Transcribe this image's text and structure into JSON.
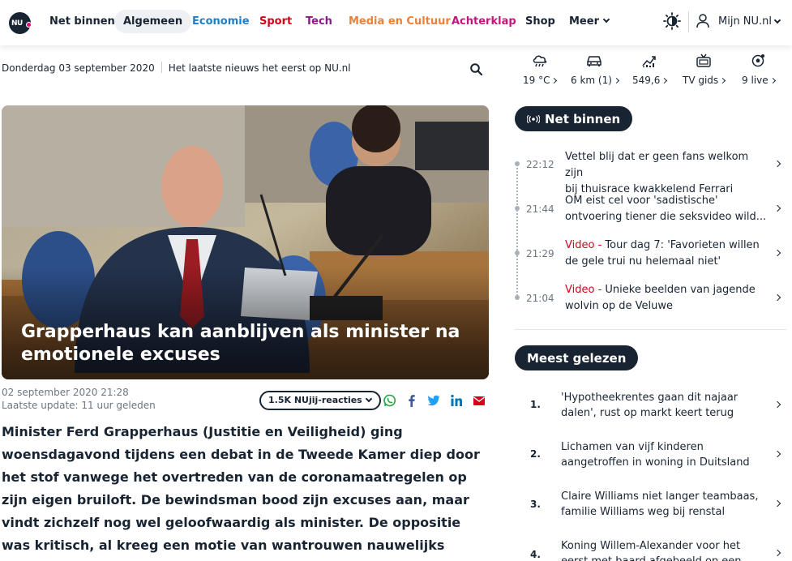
{
  "nav": {
    "logo_text": "NU",
    "items": [
      {
        "label": "Net binnen",
        "color": "#192433"
      },
      {
        "label": "Algemeen",
        "color": "#192433"
      },
      {
        "label": "Economie",
        "color": "#1c7fc8"
      },
      {
        "label": "Sport",
        "color": "#d4001a"
      },
      {
        "label": "Tech",
        "color": "#8a1a8c"
      },
      {
        "label": "Media en Cultuur",
        "color": "#e8823a"
      },
      {
        "label": "Achterklap",
        "color": "#c4177e"
      },
      {
        "label": "Shop",
        "color": "#192433"
      },
      {
        "label": "Meer",
        "color": "#192433"
      }
    ],
    "account_label": "Mijn NU.nl"
  },
  "datebar": {
    "date": "Donderdag 03 september 2020",
    "tagline": "Het laatste nieuws het eerst op NU.nl"
  },
  "widgets": [
    {
      "icon": "weather-icon",
      "value": "19 °C"
    },
    {
      "icon": "traffic-icon",
      "value": "6 km (1)"
    },
    {
      "icon": "stocks-icon",
      "value": "549,6"
    },
    {
      "icon": "tv-icon",
      "value": "TV gids"
    },
    {
      "icon": "live-sport-icon",
      "value": "9 live"
    }
  ],
  "article": {
    "headline_line1": "Grapperhaus kan aanblijven als minister na",
    "headline_line2": "emotionele excuses",
    "published": "02 september 2020 21:28",
    "updated": "Laatste update: 11 uur geleden",
    "reactions_label": "1.5K NUjij-reacties",
    "intro": "Minister Ferd Grapperhaus (Justitie en Veiligheid) ging woensdagavond tijdens een debat in de Tweede Kamer diep door het stof vanwege het overtreden van de coronamaatregelen op zijn eigen bruiloft. De bewindsman bood zijn excuses aan, maar vindt zichzelf nog wel geloofwaardig als minister. De oppositie was kritisch, al kreeg een motie van wantrouwen nauwelijks steun."
  },
  "net_binnen": {
    "title": "Net binnen",
    "items": [
      {
        "time": "22:12",
        "prefix": "",
        "line1": "Vettel blij dat er geen fans welkom zijn",
        "line2": "bij thuisrace kwakkelend Ferrari"
      },
      {
        "time": "21:44",
        "prefix": "",
        "line1": "OM eist cel voor 'sadistische'",
        "line2": "ontvoering tiener die seksvideo wild..."
      },
      {
        "time": "21:29",
        "prefix": "Video",
        "line1": "Tour dag 7: 'Favorieten willen",
        "line2": "de gele trui nu helemaal niet'"
      },
      {
        "time": "21:04",
        "prefix": "Video",
        "line1": "Unieke beelden van jagende",
        "line2": "wolvin op de Veluwe"
      }
    ]
  },
  "meest_gelezen": {
    "title": "Meest gelezen",
    "items": [
      {
        "num": "1.",
        "line1": "'Hypotheekrentes gaan dit najaar",
        "line2": "dalen', rust op markt keert terug"
      },
      {
        "num": "2.",
        "line1": "Lichamen van vijf kinderen",
        "line2": "aangetroffen in woning in Duitsland"
      },
      {
        "num": "3.",
        "line1": "Claire Williams niet langer teambaas,",
        "line2": "familie Williams weg bij renstal"
      },
      {
        "num": "4.",
        "line1": "Koning Willem-Alexander voor het",
        "line2": "eerst met baard afgebeeld op een"
      }
    ]
  }
}
